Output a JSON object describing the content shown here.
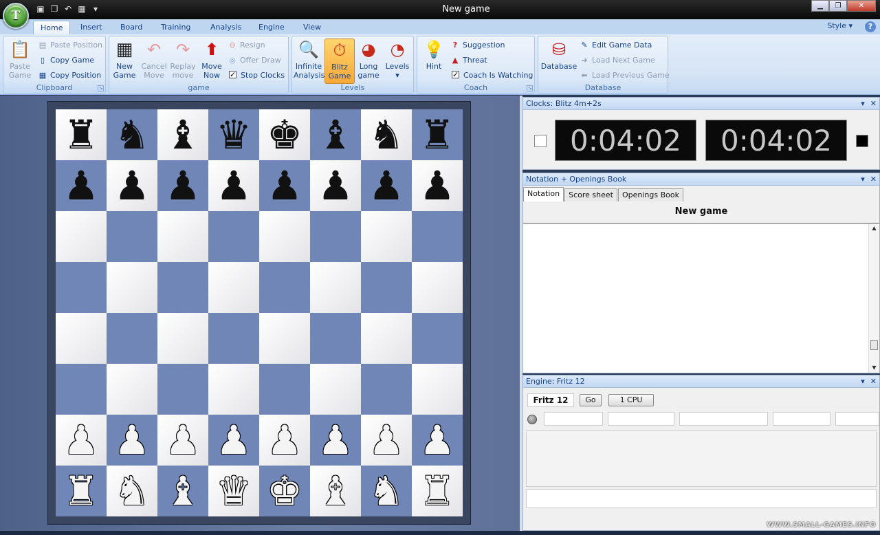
{
  "window": {
    "title": "New game",
    "logo_letter": "T",
    "qat_icons": [
      "save-icon",
      "copy-icon",
      "undo-icon",
      "board-icon",
      "customize-dropdown-icon"
    ]
  },
  "ribbon_tabs": [
    "Home",
    "Insert",
    "Board",
    "Training",
    "Analysis",
    "Engine",
    "View"
  ],
  "style_menu": "Style",
  "groups": {
    "clipboard": {
      "label": "Clipboard",
      "paste_game": "Paste Game",
      "paste_position": "Paste Position",
      "copy_game": "Copy Game",
      "copy_position": "Copy Position"
    },
    "game": {
      "label": "game",
      "new_game": "New Game",
      "cancel_move": "Cancel Move",
      "replay_move": "Replay move",
      "move_now": "Move Now",
      "resign": "Resign",
      "offer_draw": "Offer Draw",
      "stop_clocks": "Stop Clocks"
    },
    "levels": {
      "label": "Levels",
      "infinite_analysis": "Infinite Analysis",
      "blitz_game": "Blitz Game",
      "long_game": "Long game",
      "levels": "Levels"
    },
    "coach": {
      "label": "Coach",
      "hint": "Hint",
      "suggestion": "Suggestion",
      "threat": "Threat",
      "coach_is_watching": "Coach Is Watching"
    },
    "database": {
      "label": "Database",
      "database": "Database",
      "edit_game_data": "Edit Game Data",
      "load_next_game": "Load Next Game",
      "load_previous_game": "Load Previous Game"
    }
  },
  "board": {
    "rows": [
      [
        "♜",
        "♞",
        "♝",
        "♛",
        "♚",
        "♝",
        "♞",
        "♜"
      ],
      [
        "♟",
        "♟",
        "♟",
        "♟",
        "♟",
        "♟",
        "♟",
        "♟"
      ],
      [
        "",
        "",
        "",
        "",
        "",
        "",
        "",
        ""
      ],
      [
        "",
        "",
        "",
        "",
        "",
        "",
        "",
        ""
      ],
      [
        "",
        "",
        "",
        "",
        "",
        "",
        "",
        ""
      ],
      [
        "",
        "",
        "",
        "",
        "",
        "",
        "",
        ""
      ],
      [
        "♟",
        "♟",
        "♟",
        "♟",
        "♟",
        "♟",
        "♟",
        "♟"
      ],
      [
        "♜",
        "♞",
        "♝",
        "♛",
        "♚",
        "♝",
        "♞",
        "♜"
      ]
    ],
    "colors": [
      "b",
      "b",
      "",
      "",
      "",
      "",
      "w",
      "w"
    ],
    "light_color": "#ffffff",
    "dark_color": "#6f86b6"
  },
  "clocks": {
    "title": "Clocks: Blitz 4m+2s",
    "white_time": "0:04:02",
    "black_time": "0:04:02"
  },
  "notation": {
    "title": "Notation + Openings Book",
    "tabs": [
      "Notation",
      "Score sheet",
      "Openings Book"
    ],
    "game_title": "New game"
  },
  "engine": {
    "title": "Engine: Fritz 12",
    "name": "Fritz 12",
    "go_label": "Go",
    "cpu_label": "1 CPU"
  },
  "watermark": "WWW.SMALL-GAMES.INFO"
}
